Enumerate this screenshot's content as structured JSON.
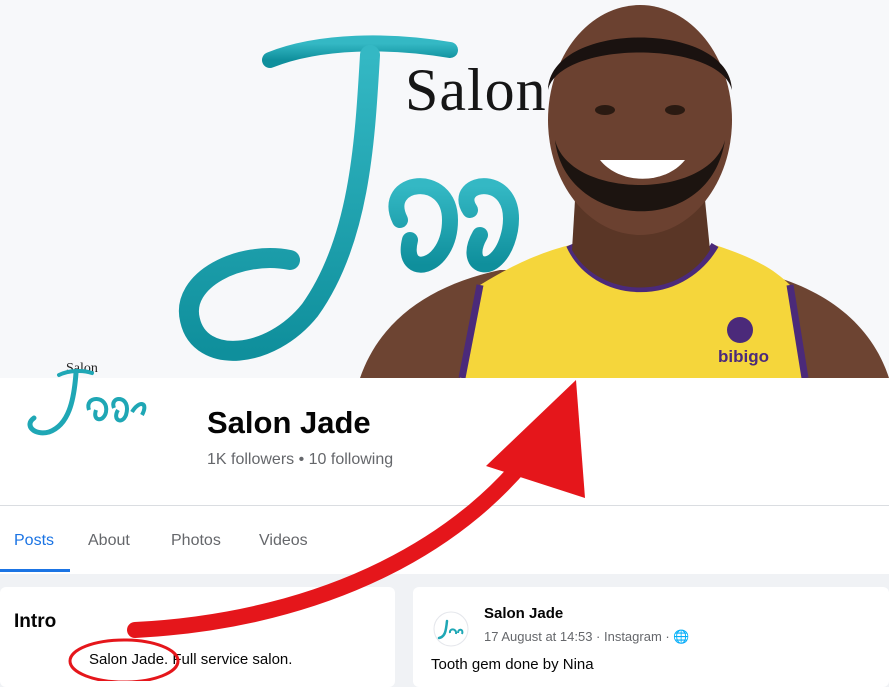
{
  "page": {
    "title": "Salon Jade",
    "stats": "1K followers • 10 following"
  },
  "cover": {
    "brand_word": "Salon",
    "script_word": "Jade",
    "jersey_text": "bibigo"
  },
  "logo": {
    "small_word": "Salon",
    "script_word": "Jade"
  },
  "tabs": [
    {
      "label": "Posts",
      "active": true
    },
    {
      "label": "About",
      "active": false
    },
    {
      "label": "Photos",
      "active": false
    },
    {
      "label": "Videos",
      "active": false
    }
  ],
  "intro": {
    "title": "Intro",
    "text": "Salon Jade. Full service salon."
  },
  "post": {
    "author": "Salon Jade",
    "meta": "17 August at 14:53 · Instagram · 🌐",
    "body": "Tooth gem done by Nina"
  },
  "colors": {
    "teal": "#1fa7b5",
    "blue_accent": "#1b74e4",
    "arrow_red": "#e5161b",
    "jersey_yellow": "#f5d63b"
  },
  "icons": [
    "globe-icon",
    "red-arrow-annotation",
    "red-circle-annotation"
  ]
}
